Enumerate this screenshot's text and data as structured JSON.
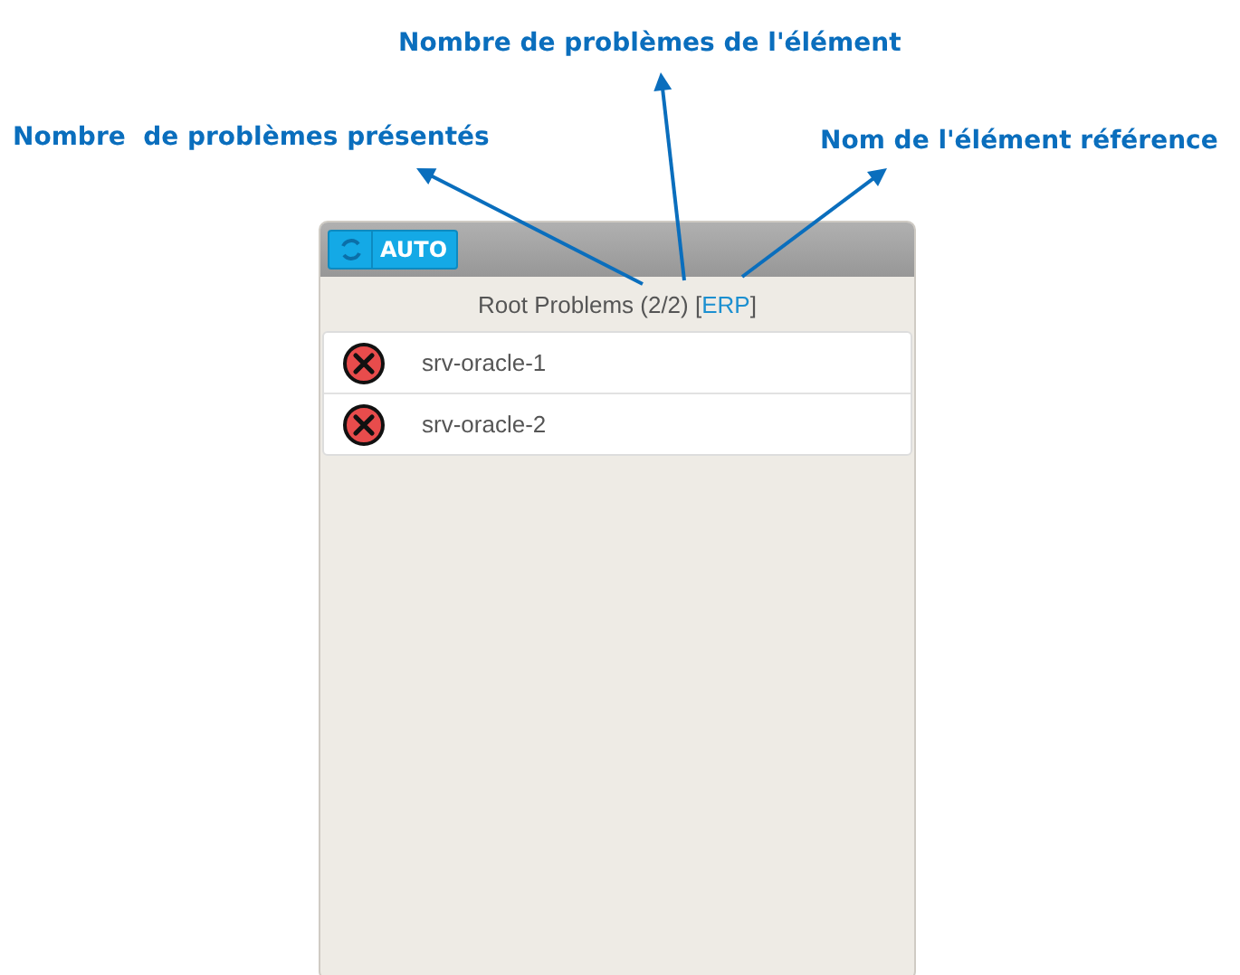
{
  "annotations": [
    {
      "text": "Nombre  de problèmes présentés",
      "kind": "count"
    },
    {
      "text": "Nombre de problèmes de l'élément",
      "kind": "total"
    },
    {
      "text": "Nom de l'élément référence",
      "kind": "reference"
    }
  ],
  "panel": {
    "refresh_label": "AUTO",
    "title_parts": [
      {
        "kind": "plain",
        "text": "Root Problems (2/2) ["
      },
      {
        "kind": "link",
        "text": "ERP"
      },
      {
        "kind": "plain",
        "text": "]"
      }
    ],
    "items": [
      {
        "name": "srv-oracle-1",
        "kind": "error"
      },
      {
        "name": "srv-oracle-2",
        "kind": "error"
      }
    ]
  }
}
